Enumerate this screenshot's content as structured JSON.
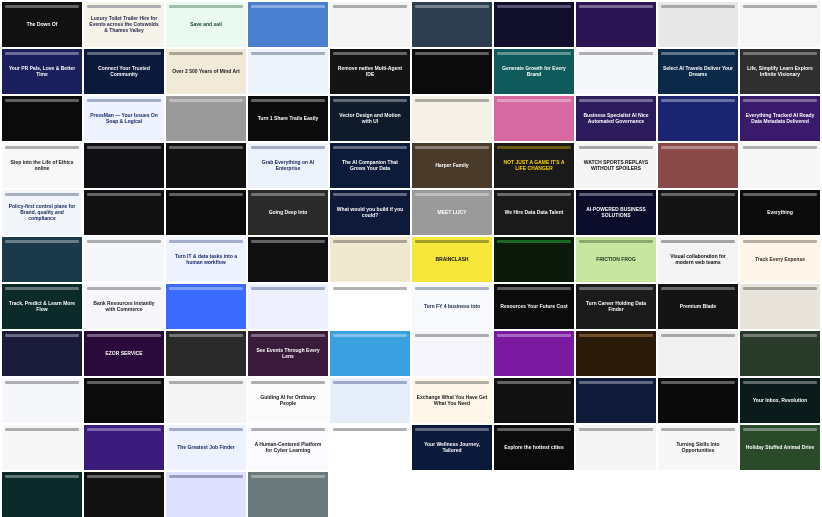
{
  "tiles": [
    {
      "bg": "#111111",
      "fg": "#ffffff",
      "headline": "The Down Of",
      "sub": ""
    },
    {
      "bg": "#f5f3ea",
      "fg": "#2a2a4a",
      "headline": "Luxury Toilet Trailer Hire for Events across the Cotswolds & Thames Valley",
      "sub": ""
    },
    {
      "bg": "#eafaf0",
      "fg": "#1a4a2a",
      "headline": "Save and sail",
      "sub": ""
    },
    {
      "bg": "#4a7fd0",
      "fg": "#ffffff",
      "headline": "",
      "sub": ""
    },
    {
      "bg": "#f4f4f4",
      "fg": "#222222",
      "headline": "",
      "sub": ""
    },
    {
      "bg": "#2c3e50",
      "fg": "#ffffff",
      "headline": "",
      "sub": ""
    },
    {
      "bg": "#120f2a",
      "fg": "#d9d0ff",
      "headline": "",
      "sub": ""
    },
    {
      "bg": "#2b1454",
      "fg": "#ffffff",
      "headline": "",
      "sub": ""
    },
    {
      "bg": "#e8e8e8",
      "fg": "#333333",
      "headline": "",
      "sub": ""
    },
    {
      "bg": "#f6f6f6",
      "fg": "#222222",
      "headline": "",
      "sub": ""
    },
    {
      "bg": "#1b1f5c",
      "fg": "#ffffff",
      "headline": "Your PR Pals, Love & Better Time",
      "sub": ""
    },
    {
      "bg": "#0b1a3a",
      "fg": "#ffffff",
      "headline": "Connect Your Trusted Community",
      "sub": ""
    },
    {
      "bg": "#f2ead8",
      "fg": "#222222",
      "headline": "Over 2 500 Years of Mind Art",
      "sub": ""
    },
    {
      "bg": "#edf3fb",
      "fg": "#1a2a4a",
      "headline": "",
      "sub": ""
    },
    {
      "bg": "#141414",
      "fg": "#ffffff",
      "headline": "Remove native Multi-Agent IDE",
      "sub": ""
    },
    {
      "bg": "#0b0b0b",
      "fg": "#ffffff",
      "headline": "",
      "sub": ""
    },
    {
      "bg": "#0f5a5a",
      "fg": "#ffffff",
      "headline": "Generate Growth for Every Brand",
      "sub": ""
    },
    {
      "bg": "#f6f7fb",
      "fg": "#222222",
      "headline": "",
      "sub": ""
    },
    {
      "bg": "#0b2a4a",
      "fg": "#ffffff",
      "headline": "Select AI Travels Deliver Your Dreams",
      "sub": ""
    },
    {
      "bg": "#2f2f2f",
      "fg": "#ffffff",
      "headline": "Life, Simplify Learn Explore Infinite Visionary",
      "sub": ""
    },
    {
      "bg": "#0b0b0b",
      "fg": "#ffffff",
      "headline": "",
      "sub": ""
    },
    {
      "bg": "#eef3ff",
      "fg": "#1a2a6a",
      "headline": "PressMan — Your Issues On Soap & Logical",
      "sub": ""
    },
    {
      "bg": "#9a9a9a",
      "fg": "#ffffff",
      "headline": "",
      "sub": ""
    },
    {
      "bg": "#0b0b0b",
      "fg": "#ffffff",
      "headline": "Turn 1 Share Trails Easily",
      "sub": ""
    },
    {
      "bg": "#0f1a2a",
      "fg": "#ffffff",
      "headline": "Vector Design and Motion with UI",
      "sub": ""
    },
    {
      "bg": "#f5f1e6",
      "fg": "#222222",
      "headline": "",
      "sub": ""
    },
    {
      "bg": "#d66aa0",
      "fg": "#ffffff",
      "headline": "",
      "sub": ""
    },
    {
      "bg": "#2b1b5c",
      "fg": "#ffffff",
      "headline": "Business Specialist AI Nice Automated Governance",
      "sub": ""
    },
    {
      "bg": "#1a2470",
      "fg": "#ffffff",
      "headline": "",
      "sub": ""
    },
    {
      "bg": "#3a1a6a",
      "fg": "#ffffff",
      "headline": "Everything Tracked AI Ready Data Metadata Delivered",
      "sub": ""
    },
    {
      "bg": "#f8f8f8",
      "fg": "#222222",
      "headline": "Step into the Life of Ethics online",
      "sub": ""
    },
    {
      "bg": "#0f0f14",
      "fg": "#ffffff",
      "headline": "",
      "sub": ""
    },
    {
      "bg": "#111111",
      "fg": "#ffffff",
      "headline": "",
      "sub": ""
    },
    {
      "bg": "#eef2fb",
      "fg": "#1a2a5a",
      "headline": "Grab Everything on AI Enterprise",
      "sub": ""
    },
    {
      "bg": "#0d1b3a",
      "fg": "#ffffff",
      "headline": "The AI Companion That Grows Your Data",
      "sub": ""
    },
    {
      "bg": "#4a3a2a",
      "fg": "#ffffff",
      "headline": "Harper Family",
      "sub": ""
    },
    {
      "bg": "#1a1a1a",
      "fg": "#ffd400",
      "headline": "NOT JUST A GAME IT'S A LIFE CHANGER",
      "sub": ""
    },
    {
      "bg": "#f5f5f5",
      "fg": "#111111",
      "headline": "WATCH SPORTS REPLAYS WITHOUT SPOILERS",
      "sub": ""
    },
    {
      "bg": "#8a4a4a",
      "fg": "#ffffff",
      "headline": "",
      "sub": ""
    },
    {
      "bg": "#f7f7f7",
      "fg": "#222222",
      "headline": "",
      "sub": ""
    },
    {
      "bg": "#f2f5fa",
      "fg": "#1a2a5a",
      "headline": "Policy-first control plane for Brand, quality and compliance",
      "sub": ""
    },
    {
      "bg": "#111111",
      "fg": "#ffffff",
      "headline": "",
      "sub": ""
    },
    {
      "bg": "#0b0b0b",
      "fg": "#ffffff",
      "headline": "",
      "sub": ""
    },
    {
      "bg": "#2a2a2a",
      "fg": "#ffffff",
      "headline": "Going Deep Into",
      "sub": ""
    },
    {
      "bg": "#0f1a3a",
      "fg": "#ffffff",
      "headline": "What would you build if you could?",
      "sub": ""
    },
    {
      "bg": "#9a9a9a",
      "fg": "#ffffff",
      "headline": "MEET LUCY",
      "sub": ""
    },
    {
      "bg": "#1a1a1a",
      "fg": "#ffffff",
      "headline": "We Hire Data Data Talent",
      "sub": ""
    },
    {
      "bg": "#0b0b2a",
      "fg": "#ffffff",
      "headline": "AI-POWERED BUSINESS SOLUTIONS",
      "sub": ""
    },
    {
      "bg": "#141414",
      "fg": "#ffffff",
      "headline": "",
      "sub": ""
    },
    {
      "bg": "#0b0b0b",
      "fg": "#ffffff",
      "headline": "Everything",
      "sub": ""
    },
    {
      "bg": "#1a3a4a",
      "fg": "#ffffff",
      "headline": "",
      "sub": ""
    },
    {
      "bg": "#f5f7fb",
      "fg": "#222222",
      "headline": "",
      "sub": ""
    },
    {
      "bg": "#eef3ff",
      "fg": "#1a2a6a",
      "headline": "Turn IT & data tasks into a human workflow",
      "sub": ""
    },
    {
      "bg": "#101010",
      "fg": "#ffffff",
      "headline": "",
      "sub": ""
    },
    {
      "bg": "#f0e9d0",
      "fg": "#222222",
      "headline": "",
      "sub": ""
    },
    {
      "bg": "#f5e83a",
      "fg": "#111111",
      "headline": "BRAINCLASH",
      "sub": ""
    },
    {
      "bg": "#0b1a0b",
      "fg": "#33ff55",
      "headline": "",
      "sub": ""
    },
    {
      "bg": "#c8e6a0",
      "fg": "#1a3a1a",
      "headline": "FRICTION FROG",
      "sub": ""
    },
    {
      "bg": "#f4f4f4",
      "fg": "#111111",
      "headline": "Visual collaboration for modern web teams",
      "sub": ""
    },
    {
      "bg": "#fff5e8",
      "fg": "#3a2a1a",
      "headline": "Track Every Expense",
      "sub": ""
    },
    {
      "bg": "#0d2a2a",
      "fg": "#ffffff",
      "headline": "Track, Predict & Learn More Flow",
      "sub": ""
    },
    {
      "bg": "#f7f7fb",
      "fg": "#222222",
      "headline": "Bank Resources Instantly with Commerce",
      "sub": ""
    },
    {
      "bg": "#3a6aff",
      "fg": "#ffffff",
      "headline": "",
      "sub": ""
    },
    {
      "bg": "#eef0ff",
      "fg": "#1a2a6a",
      "headline": "",
      "sub": ""
    },
    {
      "bg": "#ffffff",
      "fg": "#222222",
      "headline": "",
      "sub": ""
    },
    {
      "bg": "#f7f9fc",
      "fg": "#1a2a4a",
      "headline": "Turn FY 4 business into",
      "sub": ""
    },
    {
      "bg": "#0b0b0b",
      "fg": "#ffffff",
      "headline": "Resources Your Future Cost",
      "sub": ""
    },
    {
      "bg": "#1b1b1b",
      "fg": "#ffffff",
      "headline": "Turn Career Holding Data Finder",
      "sub": ""
    },
    {
      "bg": "#141414",
      "fg": "#ffffff",
      "headline": "Premium Blade",
      "sub": ""
    },
    {
      "bg": "#e8e4dc",
      "fg": "#222222",
      "headline": "",
      "sub": ""
    },
    {
      "bg": "#1a1a3a",
      "fg": "#ffffff",
      "headline": "",
      "sub": ""
    },
    {
      "bg": "#2a0a3a",
      "fg": "#ffffff",
      "headline": "EZOR SERVICE",
      "sub": ""
    },
    {
      "bg": "#2a2a2a",
      "fg": "#ffffff",
      "headline": "",
      "sub": ""
    },
    {
      "bg": "#3a1a3a",
      "fg": "#ffffff",
      "headline": "See Events Through Every Lens",
      "sub": ""
    },
    {
      "bg": "#3aa0e0",
      "fg": "#ffffff",
      "headline": "",
      "sub": ""
    },
    {
      "bg": "#f5f5fb",
      "fg": "#222222",
      "headline": "",
      "sub": ""
    },
    {
      "bg": "#7a1aa0",
      "fg": "#ffffff",
      "headline": "",
      "sub": ""
    },
    {
      "bg": "#2a1a0a",
      "fg": "#ffbb55",
      "headline": "",
      "sub": ""
    },
    {
      "bg": "#f0f0f0",
      "fg": "#222222",
      "headline": "",
      "sub": ""
    },
    {
      "bg": "#2a3a2a",
      "fg": "#ffffff",
      "headline": "",
      "sub": ""
    },
    {
      "bg": "#f5f7fb",
      "fg": "#222222",
      "headline": "",
      "sub": ""
    },
    {
      "bg": "#0b0b0b",
      "fg": "#ffffff",
      "headline": "",
      "sub": ""
    },
    {
      "bg": "#f4f4f4",
      "fg": "#222222",
      "headline": "",
      "sub": ""
    },
    {
      "bg": "#fbfbfb",
      "fg": "#222222",
      "headline": "Guiding AI for Ordinary People",
      "sub": ""
    },
    {
      "bg": "#e6eefa",
      "fg": "#1a2a6a",
      "headline": "",
      "sub": ""
    },
    {
      "bg": "#fff7ea",
      "fg": "#222222",
      "headline": "Exchange What You Have Get What You Need",
      "sub": ""
    },
    {
      "bg": "#111111",
      "fg": "#ffffff",
      "headline": "",
      "sub": ""
    },
    {
      "bg": "#0f1a3a",
      "fg": "#ffffff",
      "headline": "",
      "sub": ""
    },
    {
      "bg": "#0a0a0a",
      "fg": "#ffffff",
      "headline": "",
      "sub": ""
    },
    {
      "bg": "#0b1a1a",
      "fg": "#ffffff",
      "headline": "Your Inbox, Revolution",
      "sub": ""
    },
    {
      "bg": "#f7f7f7",
      "fg": "#222222",
      "headline": "",
      "sub": ""
    },
    {
      "bg": "#3a1a7a",
      "fg": "#ffffff",
      "headline": "",
      "sub": ""
    },
    {
      "bg": "#eef2ff",
      "fg": "#1a2a6a",
      "headline": "The Greatest Job Finder",
      "sub": ""
    },
    {
      "bg": "#fbfbff",
      "fg": "#222222",
      "headline": "A Human-Centered Platform for Cyber Learning",
      "sub": ""
    },
    {
      "bg": "#ffffff",
      "fg": "#222222",
      "headline": "",
      "sub": ""
    },
    {
      "bg": "#0b1a3a",
      "fg": "#ffffff",
      "headline": "Your Wellness Journey, Tailored",
      "sub": ""
    },
    {
      "bg": "#0b0b0b",
      "fg": "#ffffff",
      "headline": "Explore the hottest cities",
      "sub": ""
    },
    {
      "bg": "#f5f5f5",
      "fg": "#222222",
      "headline": "",
      "sub": ""
    },
    {
      "bg": "#f7f7f7",
      "fg": "#222222",
      "headline": "Turning Skills Into Opportunities",
      "sub": ""
    },
    {
      "bg": "#2a4a2a",
      "fg": "#ffffff",
      "headline": "Holiday Stuffed Animal Drive",
      "sub": ""
    },
    {
      "bg": "#0a2a2a",
      "fg": "#ffffff",
      "headline": "",
      "sub": ""
    },
    {
      "bg": "#111111",
      "fg": "#ffffff",
      "headline": "",
      "sub": ""
    },
    {
      "bg": "#e0e0ff",
      "fg": "#1a1a4a",
      "headline": "",
      "sub": ""
    },
    {
      "bg": "#6a7a7a",
      "fg": "#ffffff",
      "headline": "",
      "sub": ""
    }
  ]
}
